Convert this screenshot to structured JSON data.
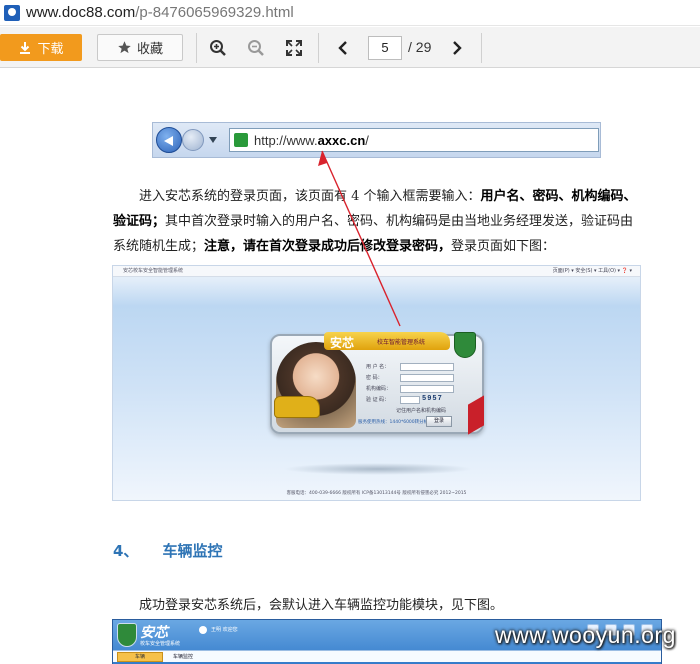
{
  "browser": {
    "url_host": "www.doc88.com",
    "url_path": "/p-8476065969329.html"
  },
  "toolbar": {
    "download_label": "下载",
    "favorite_label": "收藏",
    "current_page": "5",
    "total_pages": "/ 29"
  },
  "document": {
    "ie_url_prefix": "http://www.",
    "ie_url_domain": "axxc.cn",
    "ie_url_suffix": "/",
    "p1_a": "进入安芯系统的登录页面，该页面有 4 个输入框需要输入：",
    "p1_b": "用户名、密码、机构编码、验证码；",
    "p1_c": "其中首次登录时输入的用户名、密码、机构编码是由当地业务经理发送，验证码由系统随机生成；",
    "p1_d": "注意，请在首次登录成功后修改登录密码，",
    "p1_e": "登录页面如下图：",
    "login_shot": {
      "tab_title": "安芯校车安全智能管理系统",
      "toolbar_right": "页面(P) ▾  安全(S) ▾  工具(O) ▾  ❓ ▾",
      "brand": "安芯",
      "brand_sub": "校车智能管理系统",
      "field_labels": [
        "用 户 名：",
        "密    码：",
        "机构编码：",
        "验 证 码："
      ],
      "captcha": "5957",
      "remember_label": "记住用户名和机构编码",
      "tel_text": "服务使用热线：1440*6000转分机",
      "login_button": "登录",
      "footer": "客服电话：400-039-6666 版权所有 ICP备13013144号 版权所有侵害必究 2012~2015"
    },
    "section_number": "4、",
    "section_title": "车辆监控",
    "p2": "成功登录安芯系统后，会默认进入车辆监控功能模块，见下图。",
    "vm_shot": {
      "brand": "安芯",
      "sub": "校车安全管理系统",
      "user": "王明 欢迎您",
      "tab": "车辆",
      "tab2": "车辆监控"
    }
  },
  "watermark": "www.wooyun.org",
  "colors": {
    "download_bg": "#f29a1d",
    "heading": "#2e74b5",
    "arrow": "#d9232d"
  }
}
